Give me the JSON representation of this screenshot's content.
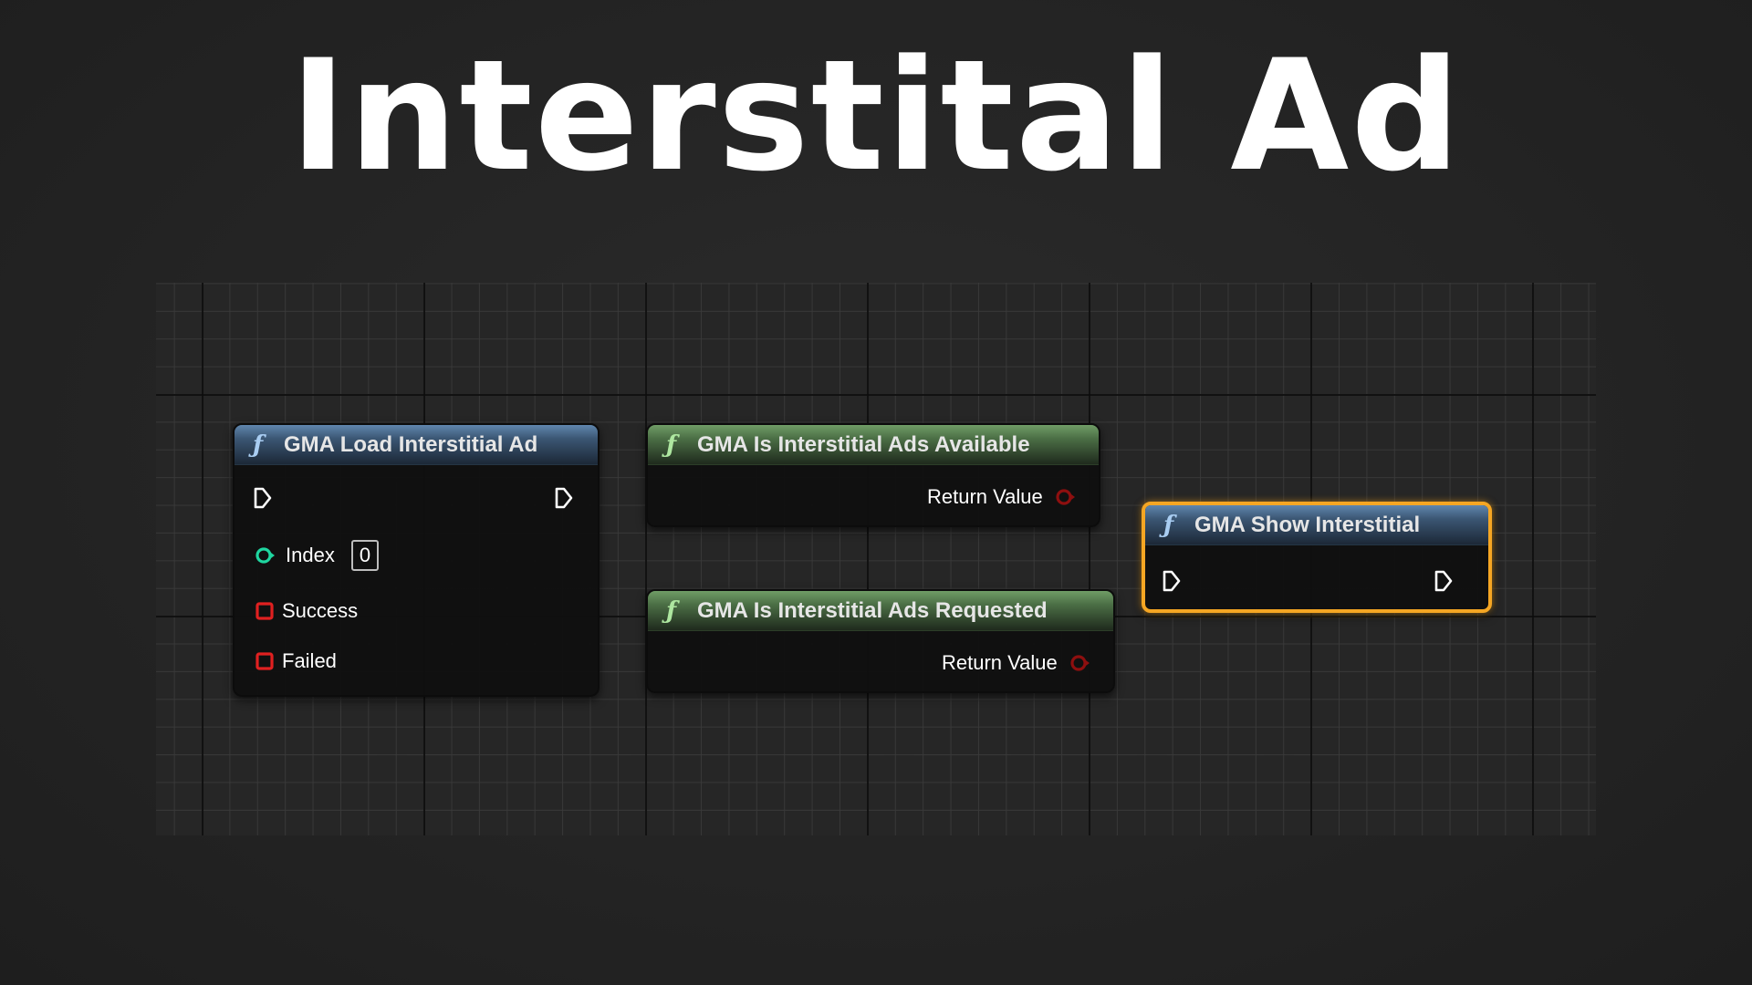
{
  "page": {
    "title": "Interstital Ad"
  },
  "graph": {
    "nodes": {
      "load_interstitial": {
        "title": "GMA Load Interstitial Ad",
        "fn_icon": "ƒ",
        "header_color": "#3b5673",
        "pins": {
          "index_label": "Index",
          "index_value": "0",
          "success_label": "Success",
          "failed_label": "Failed"
        }
      },
      "is_available": {
        "title": "GMA Is Interstitial Ads Available",
        "fn_icon": "ƒ",
        "header_color": "#4b6e45",
        "return_label": "Return Value"
      },
      "is_requested": {
        "title": "GMA Is Interstitial Ads Requested",
        "fn_icon": "ƒ",
        "header_color": "#4b6e45",
        "return_label": "Return Value"
      },
      "show_interstitial": {
        "title": "GMA Show Interstitial",
        "fn_icon": "ƒ",
        "header_color": "#3b5673",
        "selected": true,
        "selection_color": "#f5a623"
      }
    },
    "pin_colors": {
      "exec": "#ffffff",
      "integer": "#1fd6a0",
      "delegate": "#e02020",
      "boolean": "#8e0f0f"
    }
  }
}
